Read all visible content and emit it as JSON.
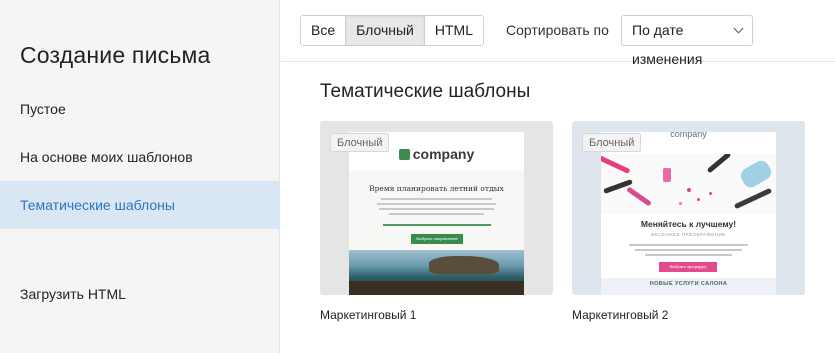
{
  "sidebar": {
    "title": "Создание письма",
    "items": [
      {
        "label": "Пустое"
      },
      {
        "label": "На основе моих шаблонов"
      },
      {
        "label": "Тематические шаблоны"
      },
      {
        "label": "Загрузить HTML"
      }
    ]
  },
  "toolbar": {
    "filters": [
      "Все",
      "Блочный",
      "HTML"
    ],
    "sort_label": "Сортировать по",
    "sort_value": "По дате изменения"
  },
  "content": {
    "section_title": "Тематические шаблоны",
    "templates": [
      {
        "name": "Маркетинговый 1",
        "badge": "Блочный",
        "preview": {
          "logo": "company",
          "headline": "Время планировать летний отдых",
          "button": "Выбрать направление",
          "accent": "#3b8a4e"
        }
      },
      {
        "name": "Маркетинговый 2",
        "badge": "Блочный",
        "preview": {
          "logo": "company",
          "headline": "Меняйтесь к лучшему!",
          "subheadline": "ВЕСЕННЕЕ ПРЕОБРАЖЕНИЕ",
          "button": "Выбрать процедуру",
          "footer": "НОВЫЕ УСЛУГИ САЛОНА",
          "accent": "#e44b8d"
        }
      }
    ]
  },
  "colors": {
    "active_item_bg": "#d9e7f5",
    "active_item_text": "#2d74bd",
    "sidebar_bg": "#f5f5f5"
  }
}
